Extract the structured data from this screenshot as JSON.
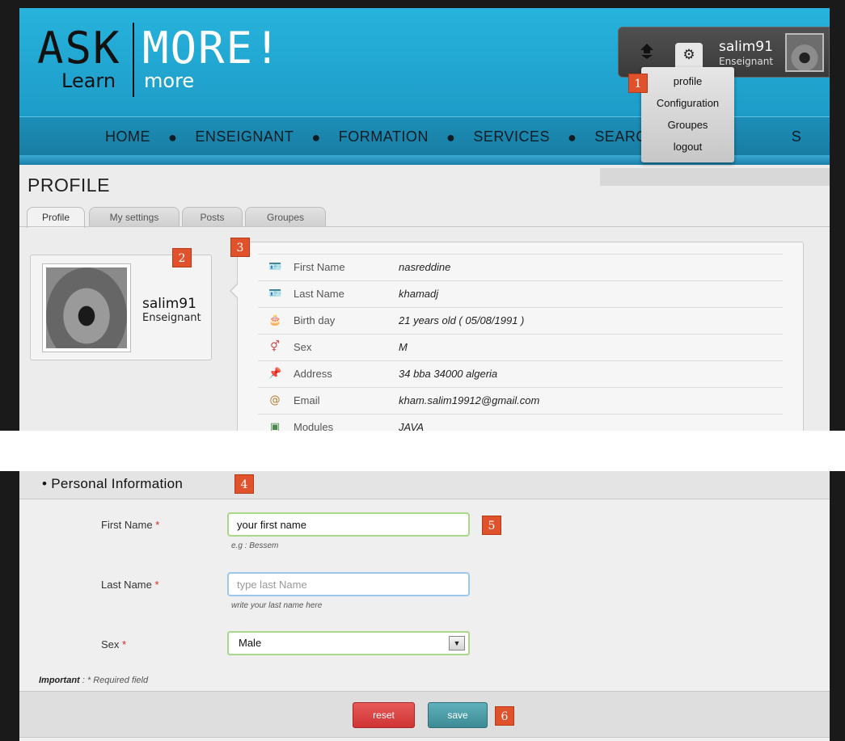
{
  "header": {
    "logo_ask": "ASK",
    "logo_more": "MORE!",
    "logo_learn": "Learn",
    "logo_more2": "more"
  },
  "user": {
    "name": "salim91",
    "role": "Enseignant"
  },
  "dropdown": {
    "items": [
      "profile",
      "Configuration",
      "Groupes",
      "logout"
    ]
  },
  "nav": {
    "items": [
      "HOME",
      "ENSEIGNANT",
      "FORMATION",
      "SERVICES",
      "SEARCH"
    ],
    "partial_item": "S"
  },
  "page": {
    "title": "PROFILE"
  },
  "tabs": [
    "Profile",
    "My settings",
    "Posts",
    "Groupes"
  ],
  "card": {
    "name": "salim91",
    "role": "Enseignant"
  },
  "info": {
    "rows": [
      {
        "icon": "id-card-icon",
        "label": "First Name",
        "value": "nasreddine"
      },
      {
        "icon": "id-card-icon",
        "label": "Last Name",
        "value": "khamadj"
      },
      {
        "icon": "cake-icon",
        "label": "Birth day",
        "value": "21 years old ( 05/08/1991 )"
      },
      {
        "icon": "gender-icon",
        "label": "Sex",
        "value": "M"
      },
      {
        "icon": "pin-icon",
        "label": "Address",
        "value": "34 bba 34000 algeria"
      },
      {
        "icon": "email-icon",
        "label": "Email",
        "value": "kham.salim19912@gmail.com"
      },
      {
        "icon": "module-icon",
        "label": "Modules",
        "value": "JAVA"
      }
    ]
  },
  "badges": [
    "1",
    "2",
    "3",
    "4",
    "5",
    "6"
  ],
  "form": {
    "section_title": "• Personal Information",
    "first_name_label": "First Name",
    "first_name_value": "your first name",
    "first_name_hint": "e.g : Bessem",
    "last_name_label": "Last Name",
    "last_name_placeholder": "type last Name",
    "last_name_hint": "write your last name here",
    "sex_label": "Sex",
    "sex_value": "Male",
    "required_mark": "*",
    "important_label": "Important",
    "important_text": " : * Required field",
    "reset_label": "reset",
    "save_label": "save"
  },
  "colors": {
    "header_blue": "#27b3dc",
    "badge": "#e0522b",
    "reset": "#cf3434",
    "save": "#3c8a94"
  }
}
